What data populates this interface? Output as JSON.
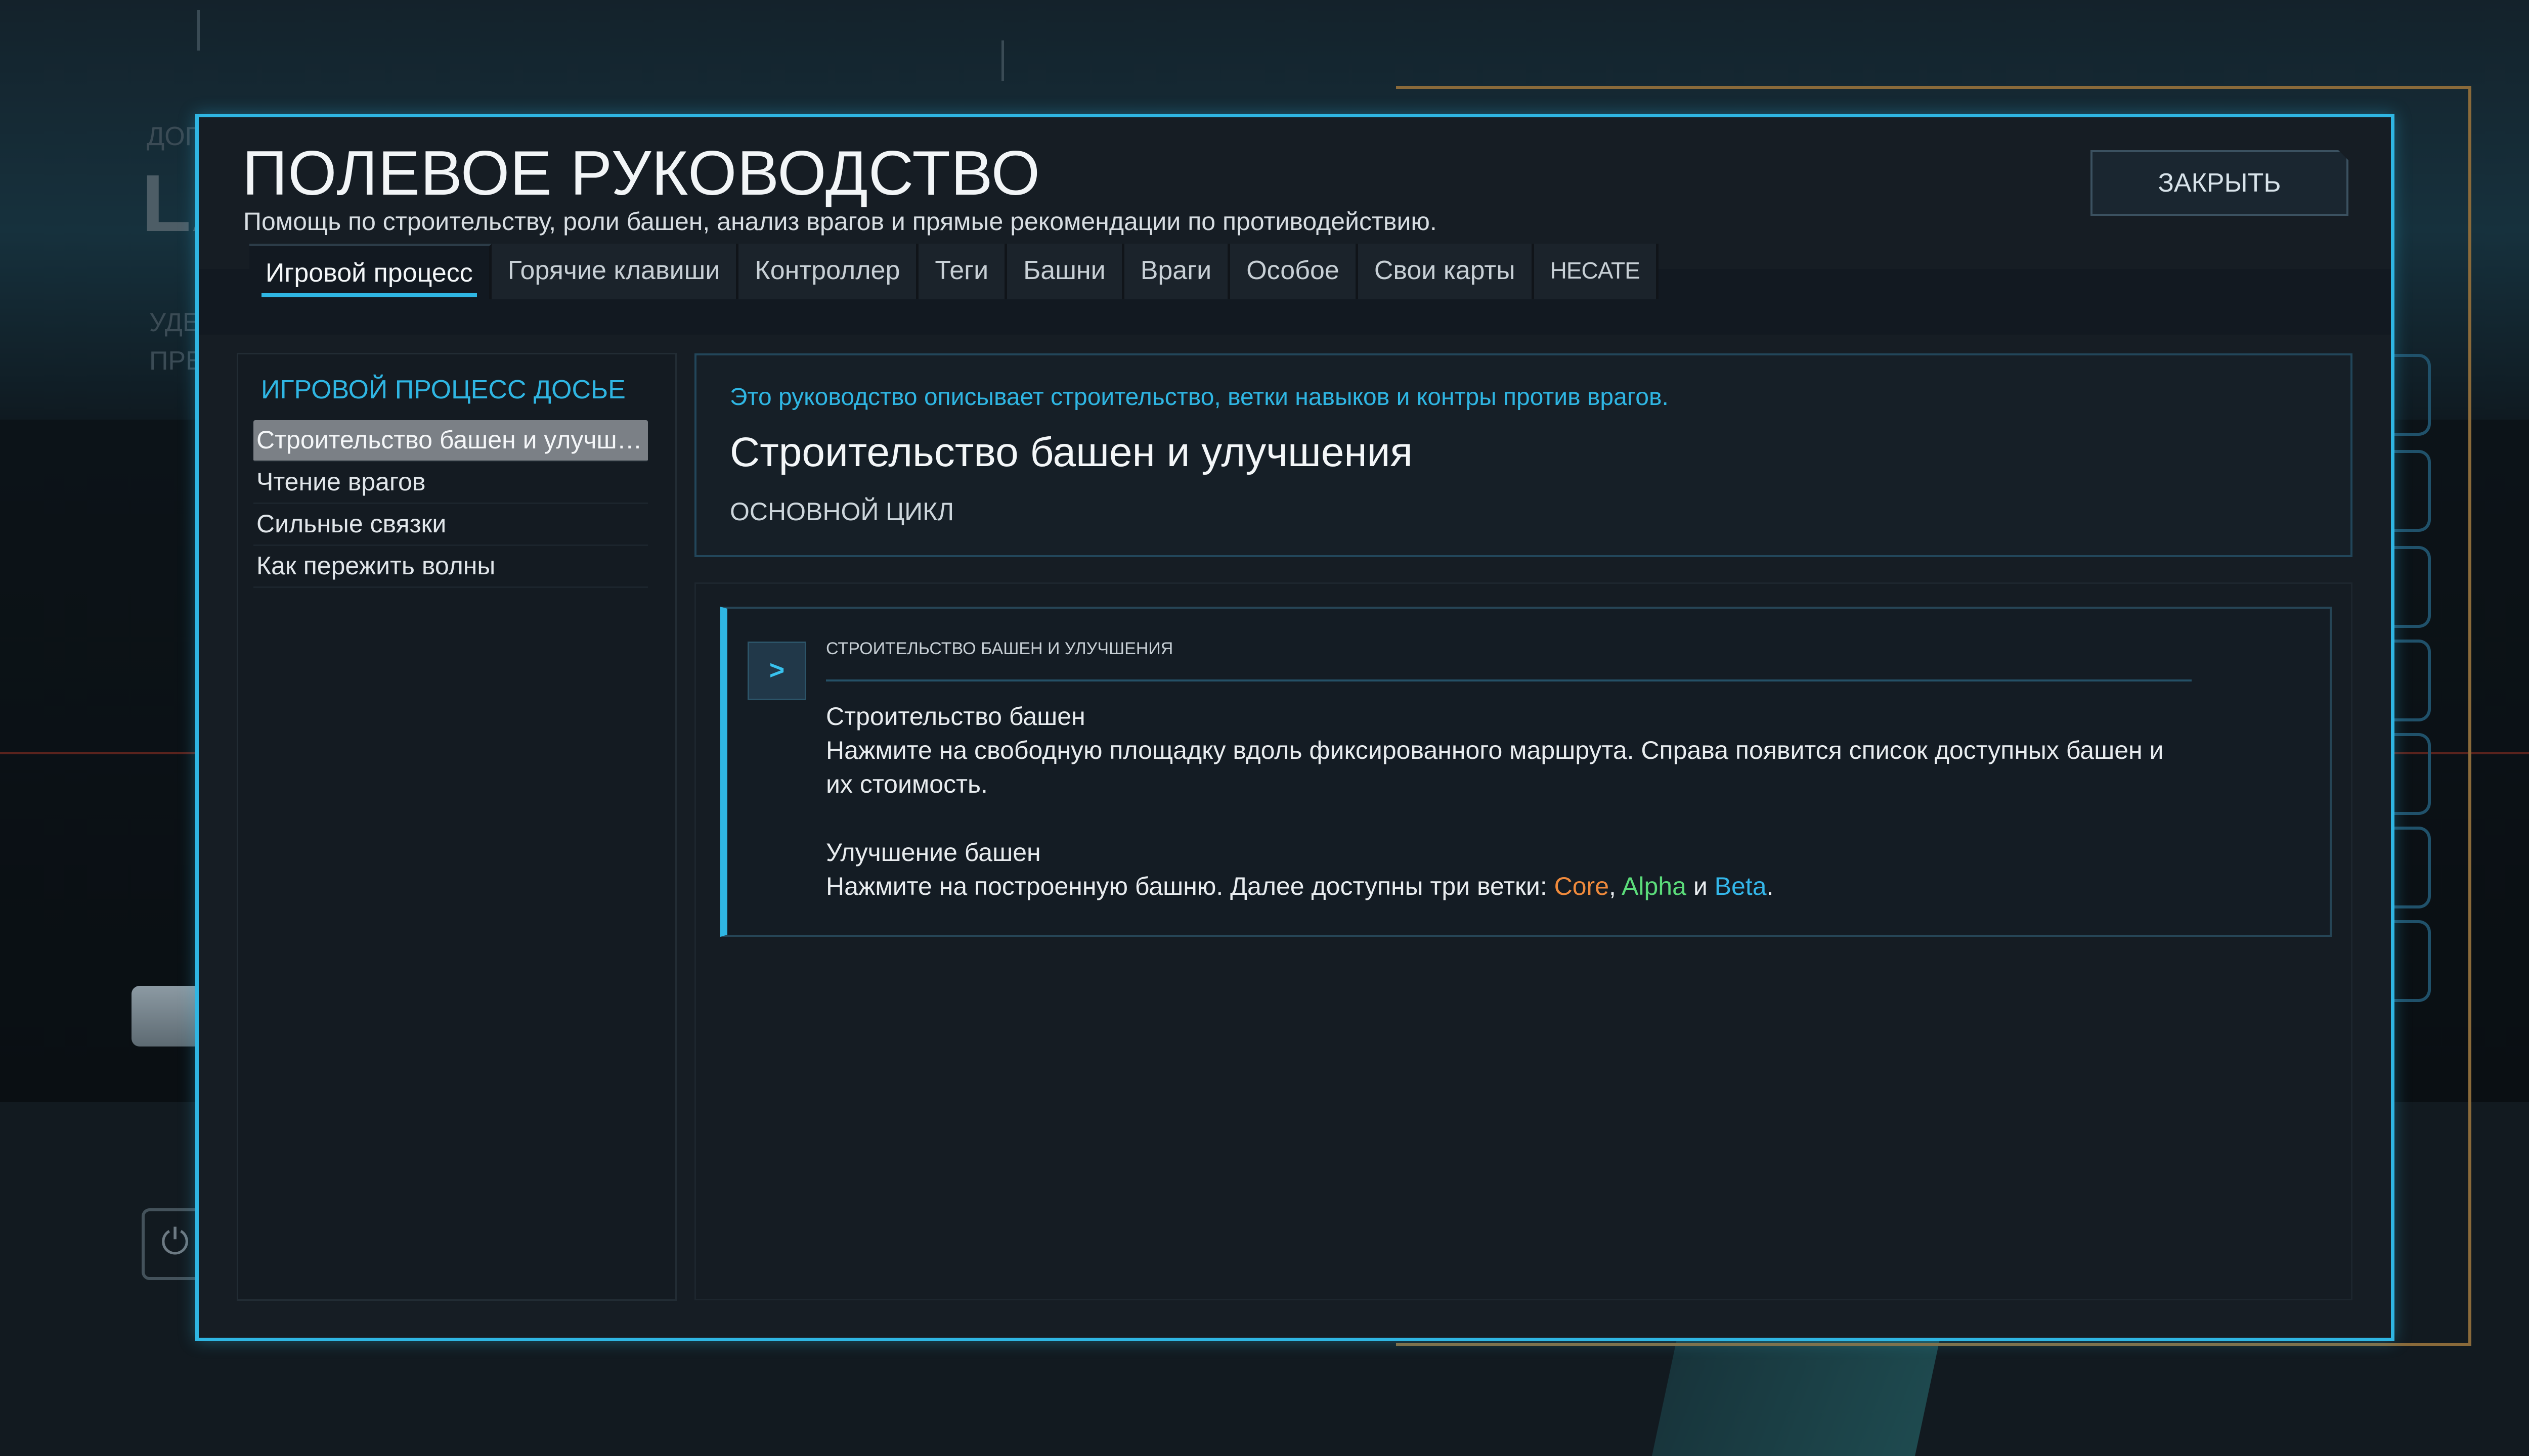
{
  "window": {
    "title": "ПОЛЕВОЕ РУКОВОДСТВО",
    "subtitle": "Помощь по строительству, роли башен, анализ врагов и прямые рекомендации по противодействию.",
    "close_label": "ЗАКРЫТЬ"
  },
  "tabs": [
    {
      "label": "Игровой процесс",
      "active": true
    },
    {
      "label": "Горячие клавиши"
    },
    {
      "label": "Контроллер"
    },
    {
      "label": "Теги"
    },
    {
      "label": "Башни"
    },
    {
      "label": "Враги"
    },
    {
      "label": "Особое"
    },
    {
      "label": "Свои карты"
    },
    {
      "label": "HECATE"
    }
  ],
  "sidebar": {
    "title": "ИГРОВОЙ ПРОЦЕСС ДОСЬЕ",
    "items": [
      {
        "label": "Строительство башен и улучшения",
        "active": true
      },
      {
        "label": "Чтение врагов"
      },
      {
        "label": "Сильные связки"
      },
      {
        "label": "Как пережить волны"
      }
    ]
  },
  "intro": {
    "lead": "Это руководство описывает строительство, ветки навыков и контры против врагов.",
    "title": "Строительство башен и улучшения",
    "kicker": "ОСНОВНОЙ ЦИКЛ"
  },
  "card": {
    "icon": "chevron-right-icon",
    "icon_glyph": ">",
    "kicker": "СТРОИТЕЛЬСТВО БАШЕН И УЛУЧШЕНИЯ",
    "section1_title": "Строительство башен",
    "section1_text": "Нажмите на свободную площадку вдоль фиксированного маршрута. Справа появится список доступных башен и их стоимость.",
    "section2_title": "Улучшение башен",
    "section2_text_prefix": "Нажмите на построенную башню. Далее доступны три ветки: ",
    "branch_core": "Core",
    "sep1": ", ",
    "branch_alpha": "Alpha",
    "sep2": " и ",
    "branch_beta": "Beta",
    "end": "."
  },
  "background": {
    "text_a": "ДОП",
    "text_b": "LA",
    "text_c1": "УДЕ",
    "text_c2": "ПРЕ",
    "power_glyph": "⏻"
  },
  "colors": {
    "accent": "#2fb6e3",
    "core": "#f08a3c",
    "alpha": "#5bdc7a",
    "beta": "#34b7ea"
  }
}
